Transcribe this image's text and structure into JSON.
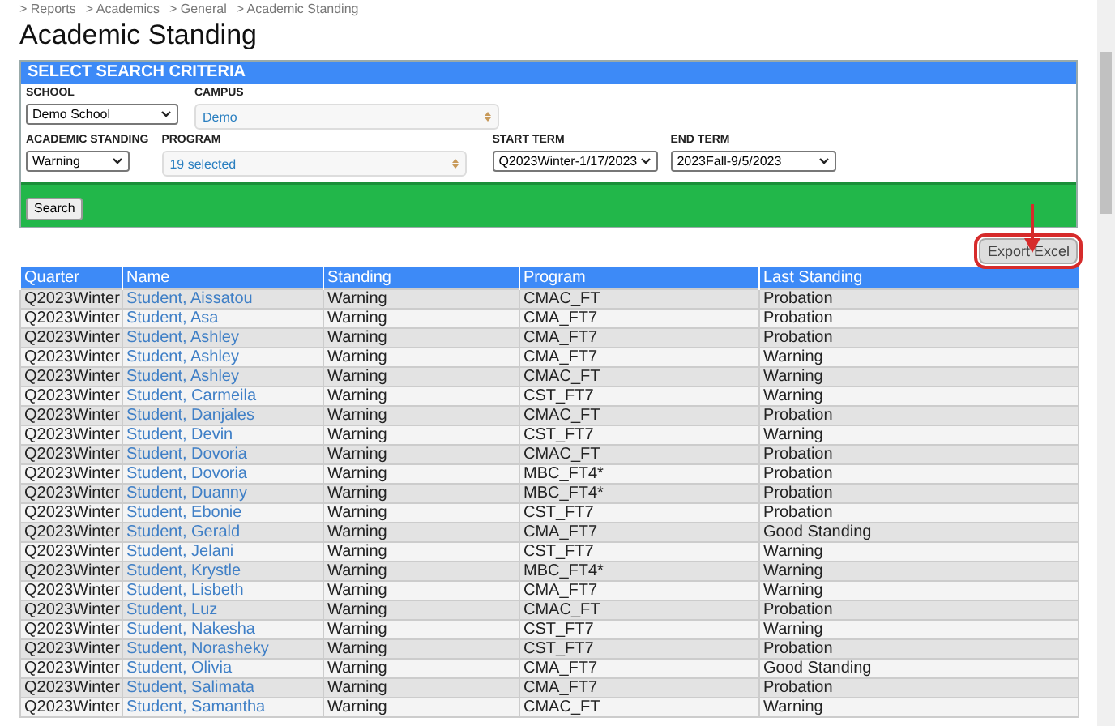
{
  "breadcrumb": [
    "> Reports",
    "> Academics",
    "> General",
    "> Academic Standing"
  ],
  "title": "Academic Standing",
  "criteria": {
    "header": "SELECT SEARCH CRITERIA",
    "school": {
      "label": "SCHOOL",
      "value": "Demo School"
    },
    "campus": {
      "label": "CAMPUS",
      "value": "Demo"
    },
    "academic_standing": {
      "label": "ACADEMIC STANDING",
      "value": "Warning"
    },
    "program": {
      "label": "PROGRAM",
      "value": "19 selected"
    },
    "start_term": {
      "label": "START TERM",
      "value": "Q2023Winter-1/17/2023"
    },
    "end_term": {
      "label": "END TERM",
      "value": "2023Fall-9/5/2023"
    },
    "search_button": "Search"
  },
  "export_button": "Export Excel",
  "table": {
    "columns": [
      "Quarter",
      "Name",
      "Standing",
      "Program",
      "Last Standing"
    ],
    "rows": [
      [
        "Q2023Winter",
        "Student, Aissatou",
        "Warning",
        "CMAC_FT",
        "Probation"
      ],
      [
        "Q2023Winter",
        "Student, Asa",
        "Warning",
        "CMA_FT7",
        "Probation"
      ],
      [
        "Q2023Winter",
        "Student, Ashley",
        "Warning",
        "CMA_FT7",
        "Probation"
      ],
      [
        "Q2023Winter",
        "Student, Ashley",
        "Warning",
        "CMA_FT7",
        "Warning"
      ],
      [
        "Q2023Winter",
        "Student, Ashley",
        "Warning",
        "CMAC_FT",
        "Warning"
      ],
      [
        "Q2023Winter",
        "Student, Carmeila",
        "Warning",
        "CST_FT7",
        "Warning"
      ],
      [
        "Q2023Winter",
        "Student, Danjales",
        "Warning",
        "CMAC_FT",
        "Probation"
      ],
      [
        "Q2023Winter",
        "Student, Devin",
        "Warning",
        "CST_FT7",
        "Warning"
      ],
      [
        "Q2023Winter",
        "Student, Dovoria",
        "Warning",
        "CMAC_FT",
        "Probation"
      ],
      [
        "Q2023Winter",
        "Student, Dovoria",
        "Warning",
        "MBC_FT4*",
        "Probation"
      ],
      [
        "Q2023Winter",
        "Student, Duanny",
        "Warning",
        "MBC_FT4*",
        "Probation"
      ],
      [
        "Q2023Winter",
        "Student, Ebonie",
        "Warning",
        "CST_FT7",
        "Probation"
      ],
      [
        "Q2023Winter",
        "Student, Gerald",
        "Warning",
        "CMA_FT7",
        "Good Standing"
      ],
      [
        "Q2023Winter",
        "Student, Jelani",
        "Warning",
        "CST_FT7",
        "Warning"
      ],
      [
        "Q2023Winter",
        "Student, Krystle",
        "Warning",
        "MBC_FT4*",
        "Warning"
      ],
      [
        "Q2023Winter",
        "Student, Lisbeth",
        "Warning",
        "CMA_FT7",
        "Warning"
      ],
      [
        "Q2023Winter",
        "Student, Luz",
        "Warning",
        "CMAC_FT",
        "Probation"
      ],
      [
        "Q2023Winter",
        "Student, Nakesha",
        "Warning",
        "CST_FT7",
        "Warning"
      ],
      [
        "Q2023Winter",
        "Student, Norasheky",
        "Warning",
        "CST_FT7",
        "Probation"
      ],
      [
        "Q2023Winter",
        "Student, Olivia",
        "Warning",
        "CMA_FT7",
        "Good Standing"
      ],
      [
        "Q2023Winter",
        "Student, Salimata",
        "Warning",
        "CMA_FT7",
        "Probation"
      ],
      [
        "Q2023Winter",
        "Student, Samantha",
        "Warning",
        "CMAC_FT",
        "Warning"
      ]
    ]
  }
}
